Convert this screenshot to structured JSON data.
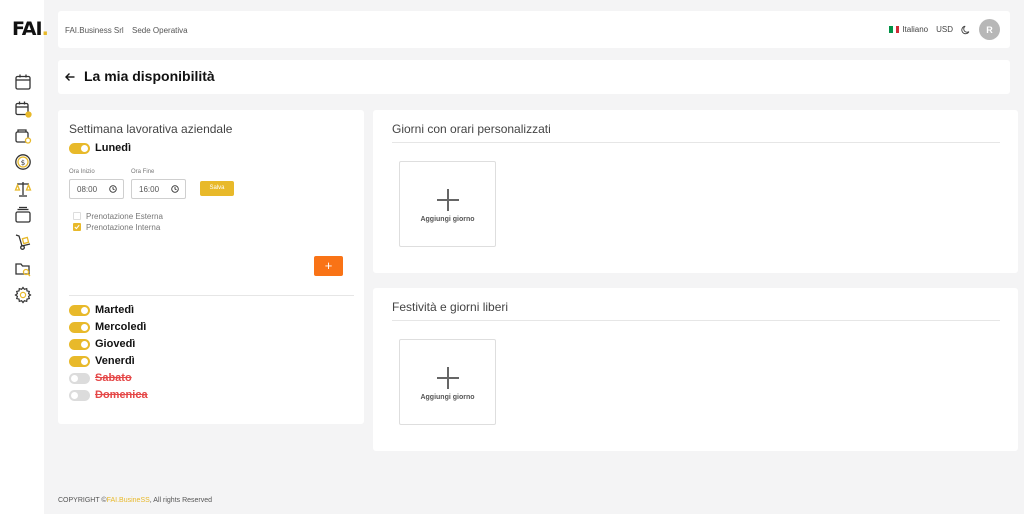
{
  "brand": {
    "logo_main": "FAI",
    "logo_dot": ".",
    "accent": "#e8b92a",
    "orange": "#f97316"
  },
  "sidebar": {
    "items": [
      {
        "icon": "calendar-icon"
      },
      {
        "icon": "calendar-user-icon"
      },
      {
        "icon": "wallet-icon"
      },
      {
        "icon": "dollar-coin-icon"
      },
      {
        "icon": "scale-icon"
      },
      {
        "icon": "layers-icon"
      },
      {
        "icon": "hand-truck-icon"
      },
      {
        "icon": "folder-search-icon"
      },
      {
        "icon": "gear-icon"
      }
    ]
  },
  "topbar": {
    "company": "FAI.Business Srl",
    "location": "Sede Operativa",
    "language": "Italiano",
    "currency": "USD",
    "avatar_initial": "R"
  },
  "page": {
    "title": "La mia disponibilità"
  },
  "week": {
    "title": "Settimana lavorativa aziendale",
    "expanded_day": {
      "label": "Lunedì",
      "start_label": "Ora Inizio",
      "start_value": "08:00",
      "end_label": "Ora Fine",
      "end_value": "16:00",
      "save_label": "Salva",
      "options": [
        {
          "label": "Prenotazione Esterna",
          "checked": false
        },
        {
          "label": "Prenotazione Interna",
          "checked": true
        }
      ],
      "add_label": "+"
    },
    "days": [
      {
        "label": "Martedì",
        "enabled": true
      },
      {
        "label": "Mercoledì",
        "enabled": true
      },
      {
        "label": "Giovedì",
        "enabled": true
      },
      {
        "label": "Venerdì",
        "enabled": true
      },
      {
        "label": "Sabato",
        "enabled": false
      },
      {
        "label": "Domenica",
        "enabled": false
      }
    ]
  },
  "custom_days": {
    "title": "Giorni con orari personalizzati",
    "add_label": "Aggiungi giorno"
  },
  "holidays": {
    "title": "Festività e giorni liberi",
    "add_label": "Aggiungi giorno"
  },
  "footer": {
    "prefix": "COPYRIGHT ©",
    "brand": "FAI.BusineSS",
    "suffix": ", All rights Reserved"
  }
}
